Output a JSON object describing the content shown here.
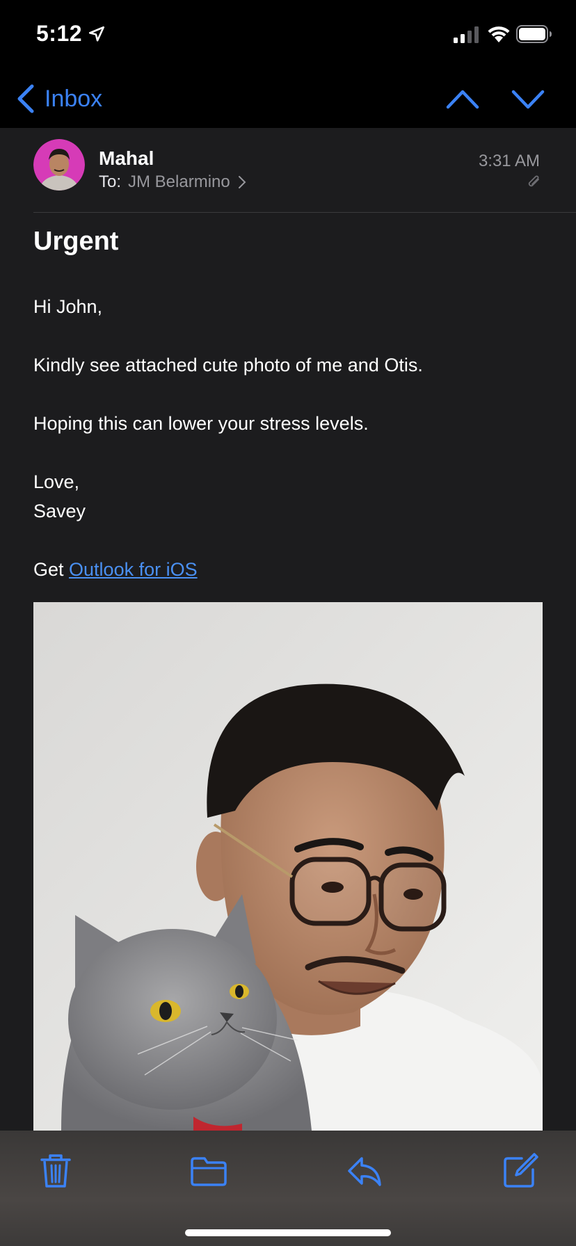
{
  "status_bar": {
    "time": "5:12",
    "icons": [
      "location-arrow-icon",
      "signal-icon",
      "wifi-icon",
      "battery-icon"
    ]
  },
  "nav": {
    "back_label": "Inbox",
    "icons": [
      "chevron-left-icon",
      "chevron-up-icon",
      "chevron-down-icon"
    ]
  },
  "message": {
    "sender": "Mahal",
    "to_label": "To:",
    "to_name": "JM Belarmino",
    "time": "3:31 AM",
    "subject": "Urgent",
    "body": {
      "greeting": "Hi John,",
      "line1": "Kindly see attached cute photo of me and Otis.",
      "line2": "Hoping this can lower your stress levels.",
      "closing": "Love,",
      "signature": "Savey",
      "footer_prefix": "Get ",
      "footer_link": "Outlook for iOS"
    }
  },
  "toolbar": {
    "icons": [
      "trash-icon",
      "folder-icon",
      "reply-icon",
      "compose-icon"
    ]
  },
  "colors": {
    "accent": "#3b82f6",
    "background": "#1c1c1e",
    "secondary_text": "#98989d"
  }
}
